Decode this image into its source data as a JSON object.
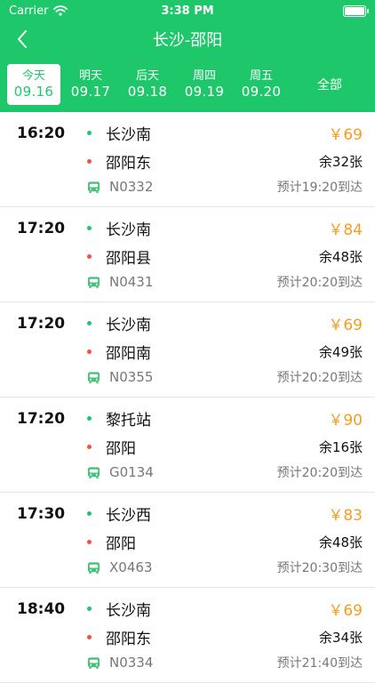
{
  "status": {
    "carrier": "Carrier",
    "time": "3:38 PM"
  },
  "nav": {
    "title": "长沙-邵阳"
  },
  "dates": [
    {
      "weekday": "今天",
      "date": "09.16",
      "active": true
    },
    {
      "weekday": "明天",
      "date": "09.17"
    },
    {
      "weekday": "后天",
      "date": "09.18"
    },
    {
      "weekday": "周四",
      "date": "09.19"
    },
    {
      "weekday": "周五",
      "date": "09.20"
    }
  ],
  "all_label": "全部",
  "trips": [
    {
      "time": "16:20",
      "from": "长沙南",
      "to": "邵阳东",
      "price": "￥69",
      "seats": "余32张",
      "code": "N0332",
      "eta": "预计19:20到达"
    },
    {
      "time": "17:20",
      "from": "长沙南",
      "to": "邵阳县",
      "price": "￥84",
      "seats": "余48张",
      "code": "N0431",
      "eta": "预计20:20到达"
    },
    {
      "time": "17:20",
      "from": "长沙南",
      "to": "邵阳南",
      "price": "￥69",
      "seats": "余49张",
      "code": "N0355",
      "eta": "预计20:20到达"
    },
    {
      "time": "17:20",
      "from": "黎托站",
      "to": "邵阳",
      "price": "￥90",
      "seats": "余16张",
      "code": "G0134",
      "eta": "预计20:20到达"
    },
    {
      "time": "17:30",
      "from": "长沙西",
      "to": "邵阳",
      "price": "￥83",
      "seats": "余48张",
      "code": "X0463",
      "eta": "预计20:30到达"
    },
    {
      "time": "18:40",
      "from": "长沙南",
      "to": "邵阳东",
      "price": "￥69",
      "seats": "余34张",
      "code": "N0334",
      "eta": "预计21:40到达"
    }
  ],
  "colors": {
    "brand": "#1ec86a",
    "price": "#f59d1e",
    "depart_dot": "#1ec86a",
    "arrive_dot": "#f0523e"
  }
}
